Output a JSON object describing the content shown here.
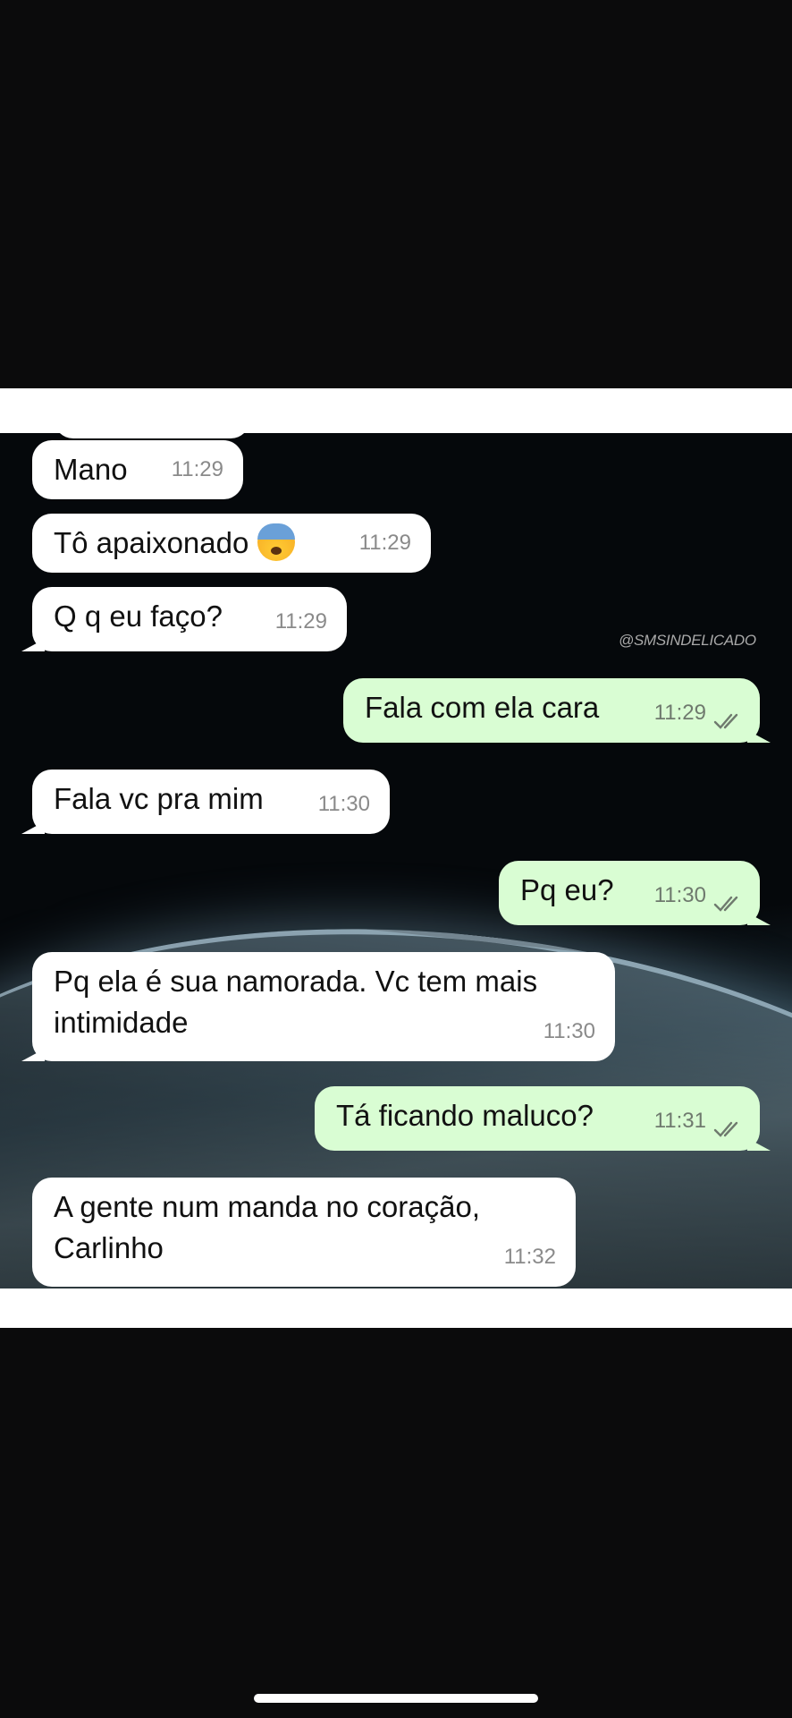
{
  "watermark": "@SMSINDELICADO",
  "messages": [
    {
      "dir": "in",
      "text": "Mano",
      "time": "11:29"
    },
    {
      "dir": "in",
      "text": "Tô apaixonado",
      "emoji": "anxious-face-with-sweat",
      "time": "11:29"
    },
    {
      "dir": "in",
      "text": "Q q eu faço?",
      "time": "11:29"
    },
    {
      "dir": "out",
      "text": "Fala com ela cara",
      "time": "11:29",
      "status": "read"
    },
    {
      "dir": "in",
      "text": "Fala vc pra mim",
      "time": "11:30"
    },
    {
      "dir": "out",
      "text": "Pq eu?",
      "time": "11:30",
      "status": "read"
    },
    {
      "dir": "in",
      "text": "Pq ela é sua namorada. Vc tem mais intimidade",
      "time": "11:30"
    },
    {
      "dir": "out",
      "text": "Tá ficando maluco?",
      "time": "11:31",
      "status": "read"
    },
    {
      "dir": "in",
      "text": "A gente num manda no coração, Carlinho",
      "time": "11:32"
    }
  ],
  "colors": {
    "incoming_bubble": "#ffffff",
    "outgoing_bubble": "#d9fdd3",
    "background": "#0b0b0c"
  }
}
